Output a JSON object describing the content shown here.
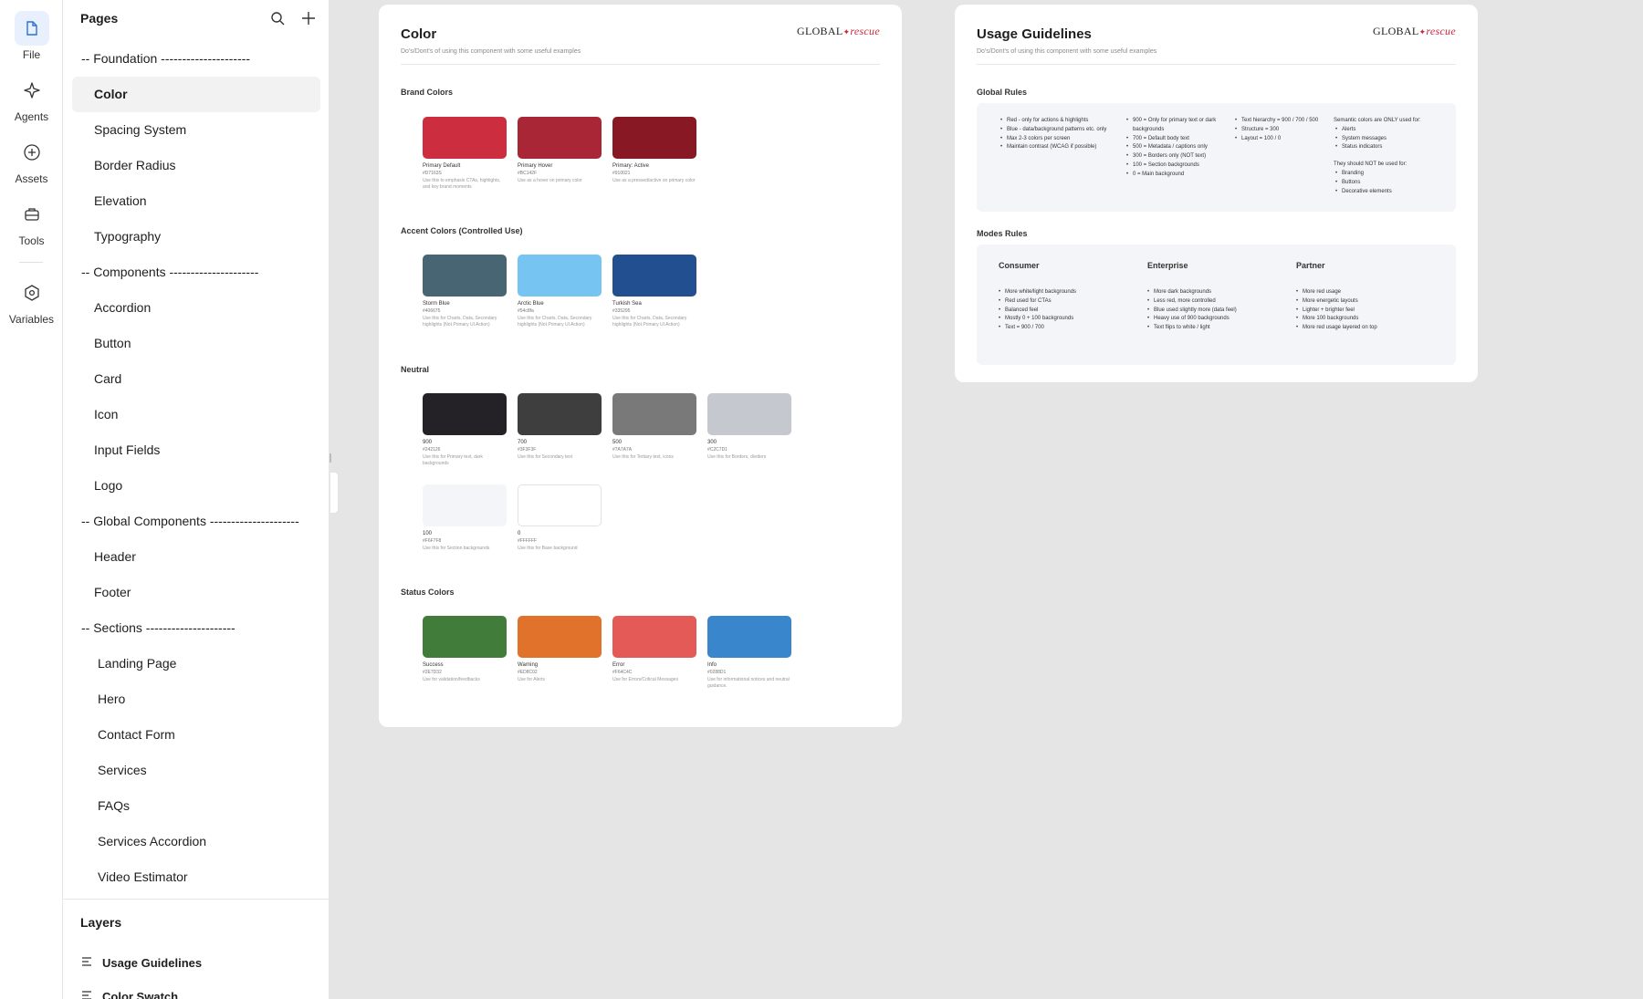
{
  "rail": {
    "items": [
      {
        "label": "File",
        "icon": "file-icon"
      },
      {
        "label": "Agents",
        "icon": "sparkle-icon"
      },
      {
        "label": "Assets",
        "icon": "plus-circle-icon"
      },
      {
        "label": "Tools",
        "icon": "toolbox-icon"
      },
      {
        "label": "Variables",
        "icon": "hexagon-icon"
      }
    ]
  },
  "pages_panel": {
    "title": "Pages",
    "items": [
      "-- Foundation ---------------------",
      "Color",
      "Spacing System",
      "Border Radius",
      "Elevation",
      "Typography",
      "-- Components ---------------------",
      "Accordion",
      "Button",
      "Card",
      "Icon",
      "Input Fields",
      "Logo",
      "-- Global Components ---------------------",
      "Header",
      "Footer",
      "-- Sections ---------------------",
      "Landing Page",
      "Hero",
      "Contact Form",
      "Services",
      "FAQs",
      "Services Accordion",
      "Video Estimator"
    ],
    "selected": "Color"
  },
  "layers_panel": {
    "title": "Layers",
    "items": [
      "Usage Guidelines",
      "Color Swatch"
    ]
  },
  "logo": {
    "global": "GLOBAL",
    "rescue": "rescue",
    "mark": "✦"
  },
  "color_frame": {
    "title": "Color",
    "subtitle": "Do's/Dont's of using this component with some useful examples",
    "sections": {
      "brand": "Brand Colors",
      "accent": "Accent Colors (Controlled Use)",
      "neutral": "Neutral",
      "status": "Status Colors"
    },
    "brand": [
      {
        "name": "Primary Default",
        "hex": "#D7163S",
        "desc": "Use this to emphasis CTAs, highlights, and key brand moments",
        "color": "#cc2d3f"
      },
      {
        "name": "Primary Hover",
        "hex": "#BC142F",
        "desc": "Use as a hover on primary color",
        "color": "#a82636"
      },
      {
        "name": "Primary: Active",
        "hex": "#910021",
        "desc": "Use as a pressed/active on primary color",
        "color": "#881824"
      }
    ],
    "accent": [
      {
        "name": "Storm Blue",
        "hex": "#406675",
        "desc": "Use this for Charts, Data, Secondary highlights (Not Primary UI Action)",
        "color": "#486573"
      },
      {
        "name": "Arctic Blue",
        "hex": "#54c8fa",
        "desc": "Use this for Charts, Data, Secondary highlights (Not Primary UI Action)",
        "color": "#76c4f2"
      },
      {
        "name": "Turkish Sea",
        "hex": "#335295",
        "desc": "Use this for Charts, Data, Secondary highlights (Not Primary UI Action)",
        "color": "#224f8f"
      }
    ],
    "neutral": [
      {
        "name": "900",
        "hex": "#242126",
        "desc": "Use this for Primary text, dark backgrounds",
        "color": "#242226"
      },
      {
        "name": "700",
        "hex": "#3F3F3F",
        "desc": "Use this for Secondary text",
        "color": "#3e3e3e"
      },
      {
        "name": "500",
        "hex": "#7A7A7A",
        "desc": "Use this for Tertiary text, icons",
        "color": "#797979"
      },
      {
        "name": "300",
        "hex": "#C2C7D1",
        "desc": "Use this for Borders, dividers",
        "color": "#c5c8cf"
      },
      {
        "name": "100",
        "hex": "#F6F7F8",
        "desc": "Use this for Section backgrounds",
        "color": "#f4f5f8"
      },
      {
        "name": "0",
        "hex": "#FFFFFF",
        "desc": "Use this for Base background",
        "color": "#ffffff"
      }
    ],
    "status": [
      {
        "name": "Success",
        "hex": "#2E7D32",
        "desc": "Use for validation/feedbacks",
        "color": "#417c3a"
      },
      {
        "name": "Warning",
        "hex": "#ED8C02",
        "desc": "Use for Alerts",
        "color": "#e0722c"
      },
      {
        "name": "Error",
        "hex": "#F64C4C",
        "desc": "Use for Errors/Critical Messages",
        "color": "#e35a57"
      },
      {
        "name": "Info",
        "hex": "#0288D1",
        "desc": "Use for informational notices and neutral guidance.",
        "color": "#3a86cc"
      }
    ]
  },
  "usage_frame": {
    "title": "Usage Guidelines",
    "subtitle": "Do's/Dont's of using this component with some useful examples",
    "global_rules_title": "Global Rules",
    "global_rules": {
      "col1": [
        "Red - only for actions & highlights",
        "Blue - data/background patterns etc. only",
        "Max 2-3 colors per screen",
        "Maintain contrast (WCAG if possible)"
      ],
      "col2": [
        "900 = Only for primary text or dark backgrounds",
        "700 = Default body text",
        "500 = Metadata / captions only",
        "300 = Borders only (NOT text)",
        "100 = Section backgrounds",
        "0 = Main background"
      ],
      "col3": [
        "Text hierarchy = 900 / 700 / 500",
        "Structure = 300",
        "Layout = 100 / 0"
      ],
      "col4_lead": "Semantic colors are ONLY used for:",
      "col4": [
        "Alerts",
        "System messages",
        "Status indicators"
      ],
      "col4_lead2": "They should NOT be used for:",
      "col4b": [
        "Branding",
        "Buttons",
        "Decorative elements"
      ]
    },
    "modes_title": "Modes Rules",
    "modes": [
      {
        "title": "Consumer",
        "items": [
          "More white/light backgrounds",
          "Red used for CTAs",
          "Balanced feel",
          "Mostly 0 + 100 backgrounds",
          "Text = 900 / 700"
        ]
      },
      {
        "title": "Enterprise",
        "items": [
          "More dark backgrounds",
          "Less red, more controlled",
          "Blue used slightly more (data feel)",
          "Heavy use of 900 backgrounds",
          "Text flips to white / light"
        ]
      },
      {
        "title": "Partner",
        "items": [
          "More red usage",
          "More energetic layouts",
          "Lighter + brighter feel",
          "More 100 backgrounds",
          "More red usage layered on top"
        ]
      }
    ]
  }
}
